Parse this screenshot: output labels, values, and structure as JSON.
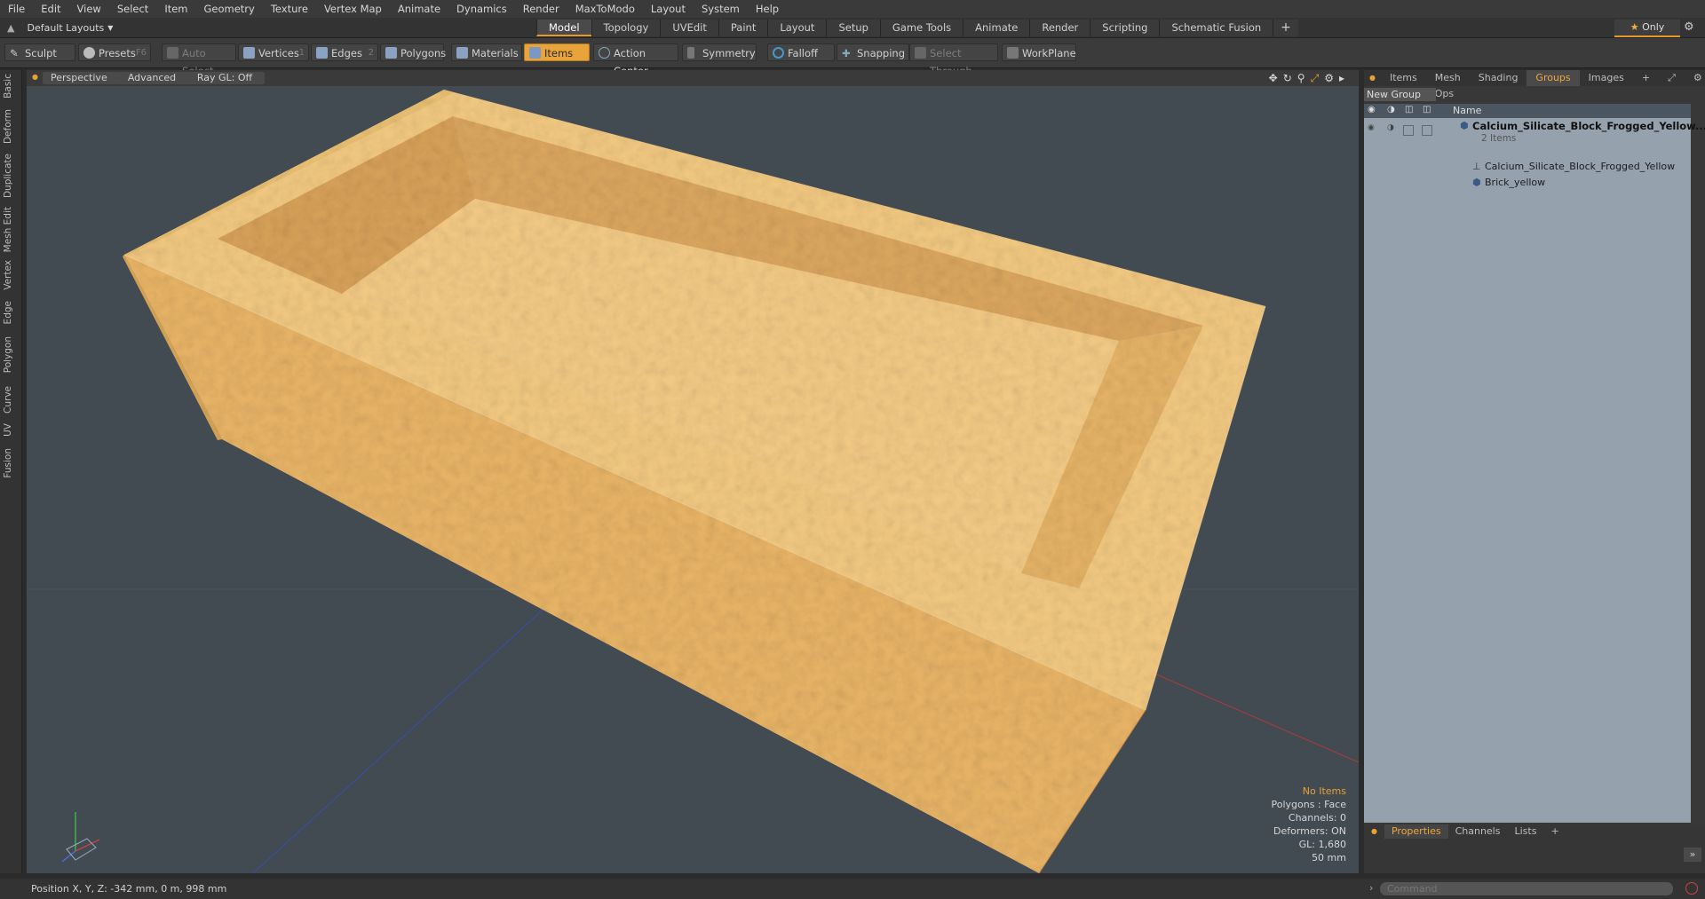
{
  "menu": [
    "File",
    "Edit",
    "View",
    "Select",
    "Item",
    "Geometry",
    "Texture",
    "Vertex Map",
    "Animate",
    "Dynamics",
    "Render",
    "MaxToModo",
    "Layout",
    "System",
    "Help"
  ],
  "layout": {
    "label": "Default Layouts"
  },
  "tabs": [
    {
      "label": "Model",
      "active": true
    },
    {
      "label": "Topology",
      "active": false
    },
    {
      "label": "UVEdit",
      "active": false
    },
    {
      "label": "Paint",
      "active": false
    },
    {
      "label": "Layout",
      "active": false
    },
    {
      "label": "Setup",
      "active": false
    },
    {
      "label": "Game Tools",
      "active": false
    },
    {
      "label": "Animate",
      "active": false
    },
    {
      "label": "Render",
      "active": false
    },
    {
      "label": "Scripting",
      "active": false
    },
    {
      "label": "Schematic Fusion",
      "active": false
    }
  ],
  "only_label": "Only",
  "toolbar": {
    "sculpt": "Sculpt",
    "presets": "Presets",
    "presets_key": "F6",
    "auto_select": "Auto Select",
    "vertices": "Vertices",
    "vertices_key": "1",
    "edges": "Edges",
    "edges_key": "2",
    "polygons": "Polygons",
    "materials": "Materials",
    "items": "Items",
    "action_center": "Action Center",
    "symmetry": "Symmetry",
    "falloff": "Falloff",
    "snapping": "Snapping",
    "select_through": "Select Through",
    "workplane": "WorkPlane"
  },
  "viewport": {
    "view": "Perspective",
    "shading": "Advanced",
    "raygl": "Ray GL: Off",
    "info": {
      "items": "No Items",
      "polygons": "Polygons : Face",
      "channels": "Channels: 0",
      "deformers": "Deformers: ON",
      "gl": "GL: 1,680",
      "size": "50 mm"
    }
  },
  "left_tabs": [
    "Basic",
    "Deform",
    "Duplicate",
    "Mesh Edit",
    "Vertex",
    "Edge",
    "Polygon",
    "Curve",
    "UV",
    "Fusion"
  ],
  "right_panel": {
    "tabs": [
      {
        "label": "Items",
        "active": false
      },
      {
        "label": "Mesh Ops",
        "active": false
      },
      {
        "label": "Shading",
        "active": false
      },
      {
        "label": "Groups",
        "active": true
      },
      {
        "label": "Images",
        "active": false
      }
    ],
    "new_group": "New Group",
    "col_name": "Name",
    "group_name": "Calcium_Silicate_Block_Frogged_Yellow...",
    "group_count": "2 Items",
    "children": [
      "Calcium_Silicate_Block_Frogged_Yellow",
      "Brick_yellow"
    ],
    "bottom_tabs": [
      {
        "label": "Properties",
        "active": true
      },
      {
        "label": "Channels",
        "active": false
      },
      {
        "label": "Lists",
        "active": false
      }
    ]
  },
  "status": {
    "position": "Position X, Y, Z:  -342 mm, 0 m, 998 mm"
  },
  "command": {
    "placeholder": "Command"
  },
  "colors": {
    "accent": "#e8a43a",
    "brick": "#e8b86a",
    "viewport_bg": "#424a52"
  }
}
